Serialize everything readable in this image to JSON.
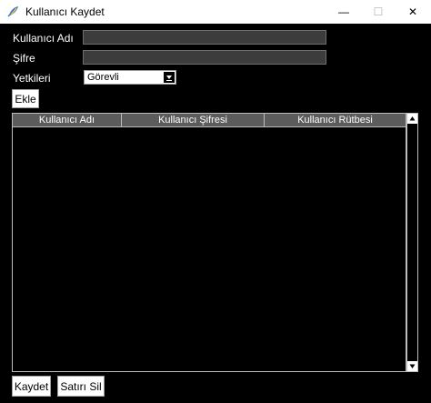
{
  "window": {
    "title": "Kullanıcı Kaydet",
    "minimize_glyph": "—",
    "maximize_glyph": "☐",
    "close_glyph": "✕"
  },
  "form": {
    "username_label": "Kullanıcı Adı",
    "username_value": "",
    "password_label": "Şifre",
    "password_value": "",
    "role_label": "Yetkileri",
    "role_selected": "Görevli",
    "add_button": "Ekle"
  },
  "table": {
    "columns": [
      "Kullanıcı Adı",
      "Kullanıcı Şifresi",
      "Kullanıcı Rütbesi"
    ],
    "rows": []
  },
  "footer": {
    "save_button": "Kaydet",
    "delete_row_button": "Satırı Sil"
  },
  "colors": {
    "background": "#000000",
    "entry_bg": "#3c3c3c",
    "header_bg": "#5c5c5c"
  },
  "icons": {
    "app": "python-feather-icon",
    "combo": "chevron-down-icon",
    "scroll_up": "arrow-up-icon",
    "scroll_down": "arrow-down-icon"
  }
}
